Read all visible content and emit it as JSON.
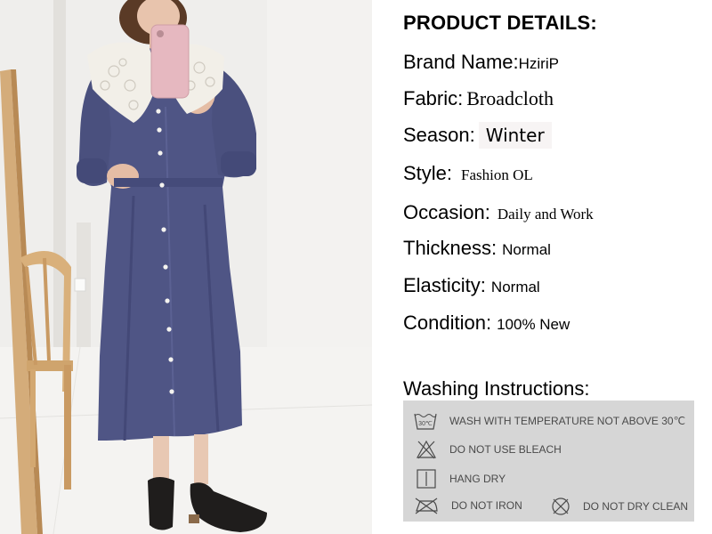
{
  "heading": "PRODUCT DETAILS:",
  "details": {
    "brand": {
      "label": "Brand Name:",
      "value": "HziriP"
    },
    "fabric": {
      "label": "Fabric:",
      "value": "Broadcloth"
    },
    "season": {
      "label": "Season:",
      "value": "Winter"
    },
    "style": {
      "label": "Style:",
      "value": "Fashion OL"
    },
    "occasion": {
      "label": "Occasion:",
      "value": "Daily and Work"
    },
    "thickness": {
      "label": "Thickness:",
      "value": "Normal"
    },
    "elasticity": {
      "label": "Elasticity:",
      "value": "Normal"
    },
    "condition": {
      "label": "Condition:",
      "value": "100% New"
    }
  },
  "washing": {
    "title": "Washing Instructions:",
    "items": {
      "wash": {
        "icon": "wash-30-icon",
        "text": "WASH WITH TEMPERATURE NOT ABOVE 30℃",
        "badge": "30℃"
      },
      "bleach": {
        "icon": "no-bleach-icon",
        "text": "DO NOT USE BLEACH"
      },
      "hang": {
        "icon": "hang-dry-icon",
        "text": "HANG DRY"
      },
      "iron": {
        "icon": "no-iron-icon",
        "text": "DO NOT IRON"
      },
      "dry": {
        "icon": "no-dry-clean-icon",
        "text": "DO NOT DRY CLEAN"
      }
    }
  },
  "colors": {
    "dress": "#4f5585",
    "wash_panel": "#d6d6d6",
    "wash_text": "#4a4a4a",
    "phone": "#e6b8c0"
  }
}
